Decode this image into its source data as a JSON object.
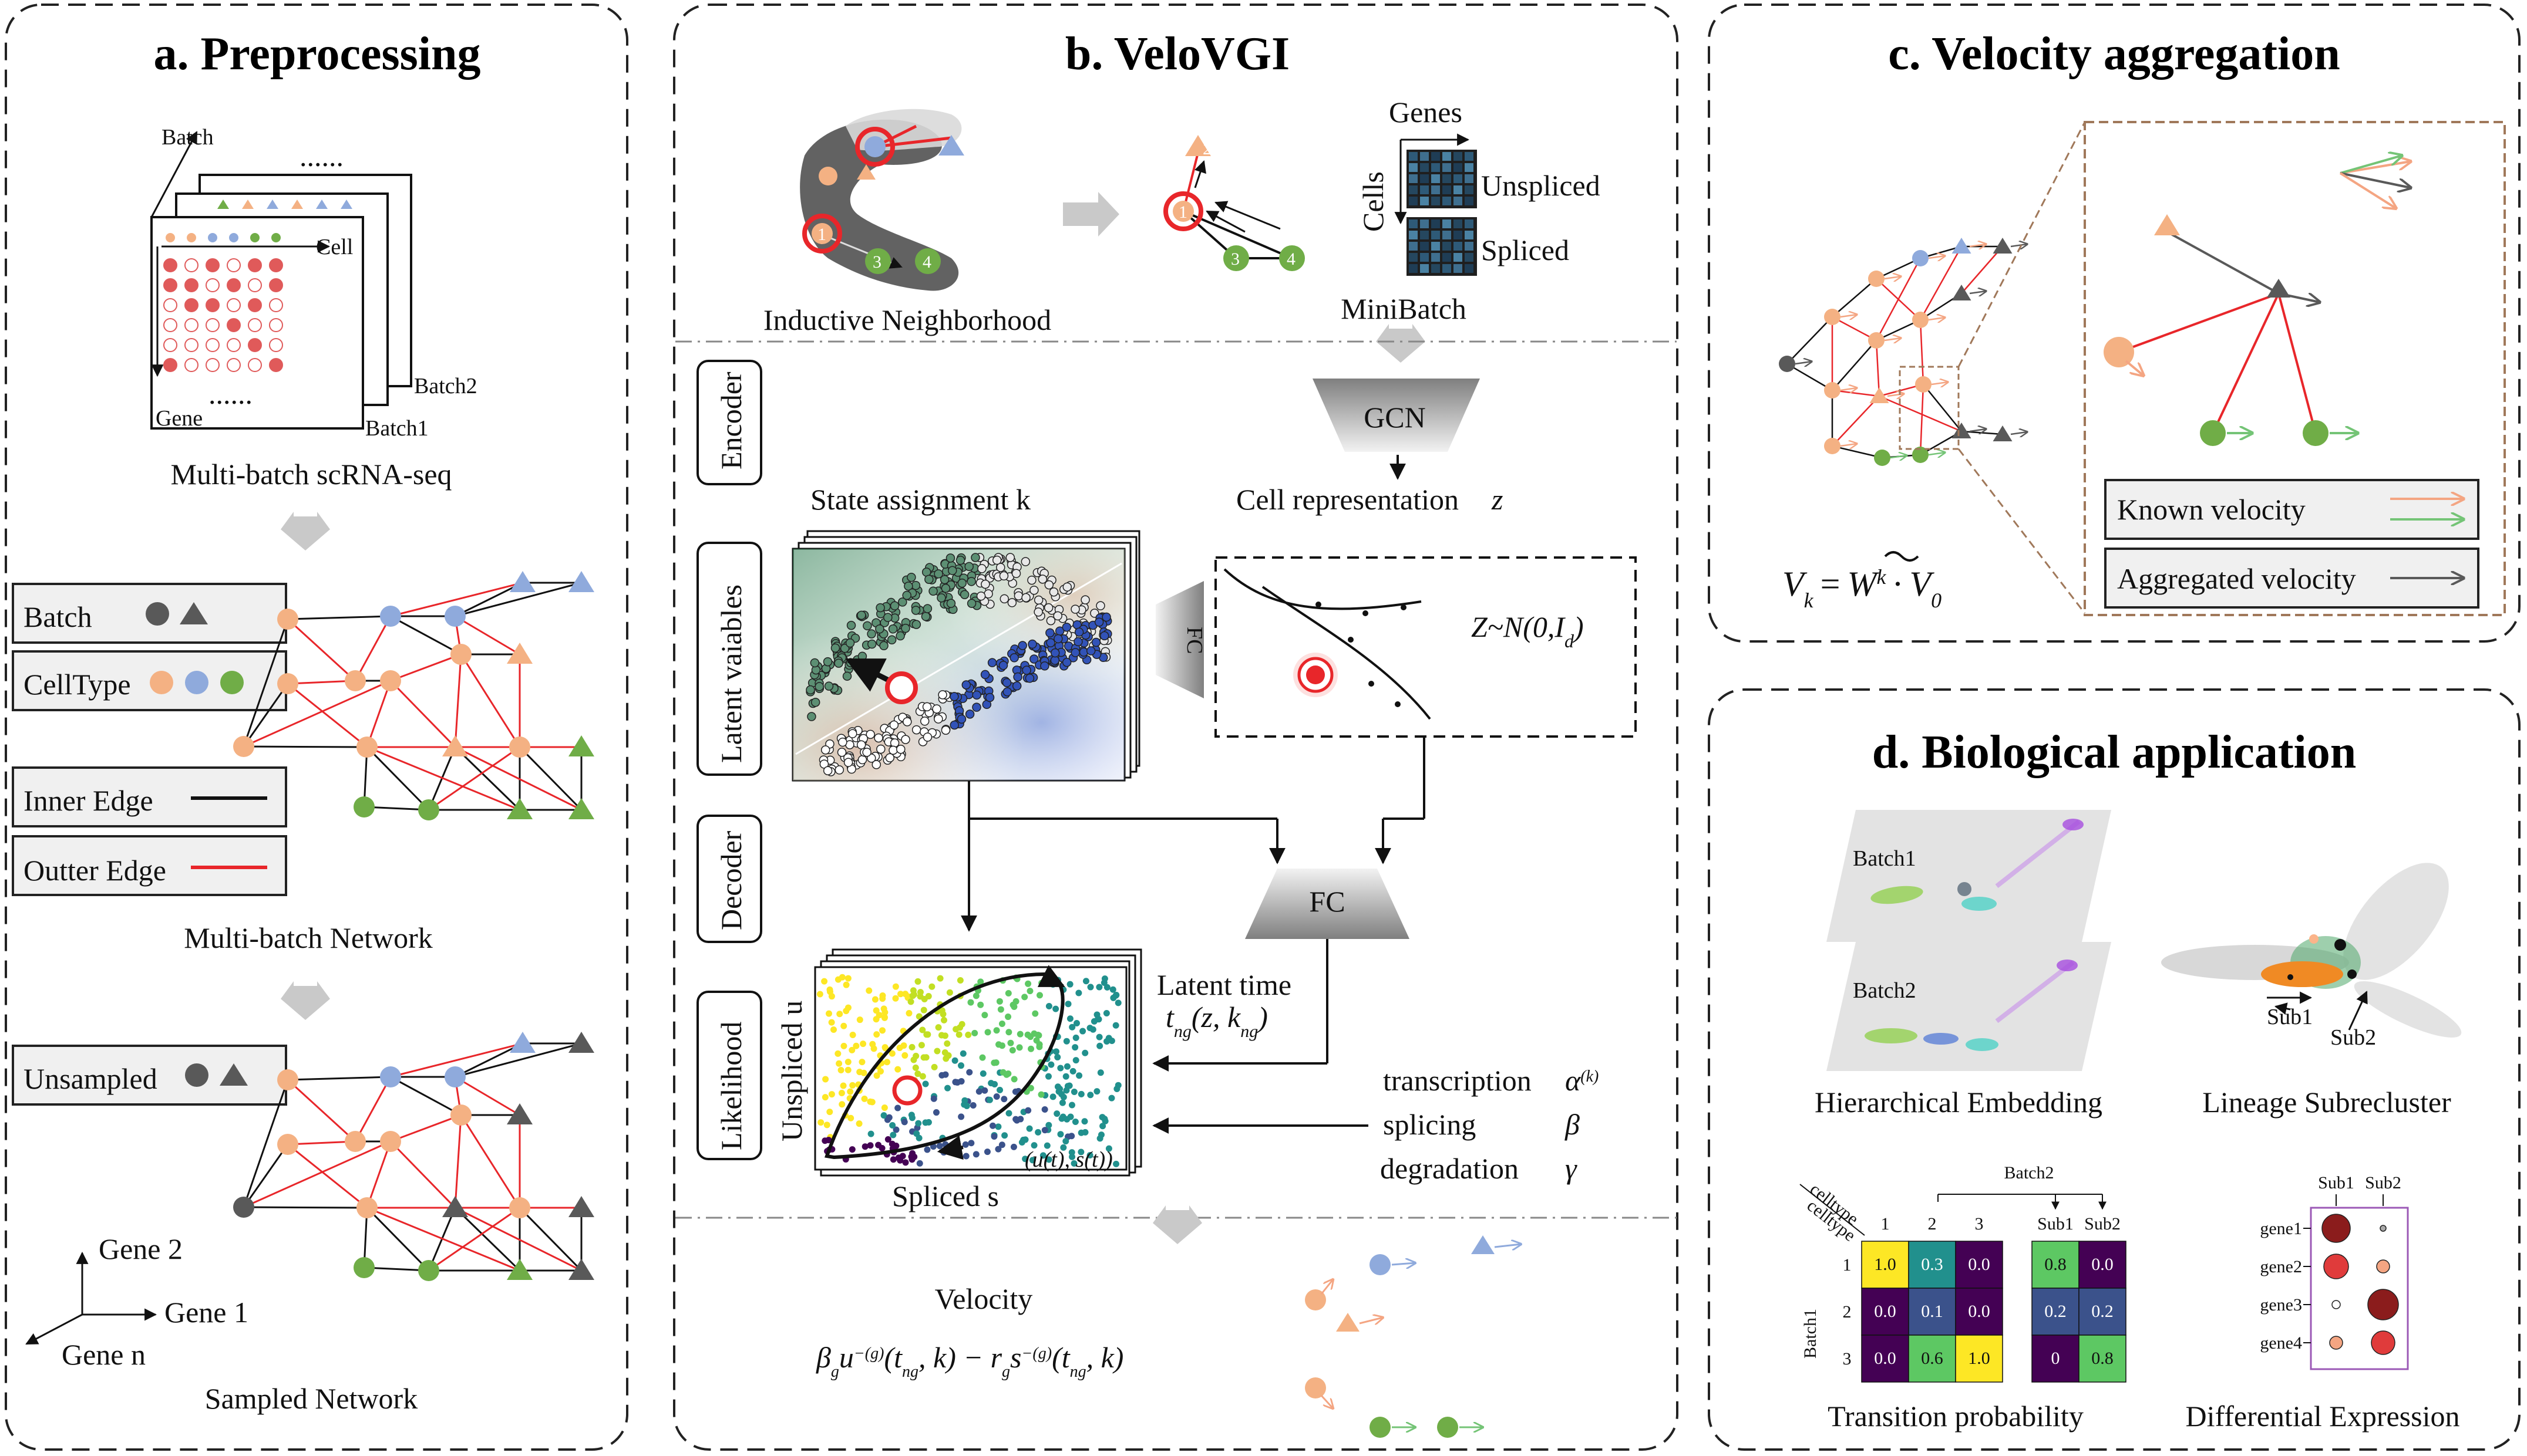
{
  "colors": {
    "orange": "#f4b183",
    "blue": "#8faadc",
    "green": "#70ad47",
    "dark": "#595959",
    "red": "#e8262a",
    "black": "#111111",
    "heat_purple": "#440154",
    "heat_blue": "#3b528b",
    "heat_teal": "#21908d",
    "heat_green": "#5dc863",
    "heat_yellow": "#fde725",
    "known_orange": "#f4a582",
    "known_green": "#74c476",
    "aggregated": "#595959"
  },
  "panel_a": {
    "title": "a. Preprocessing",
    "matrix_batch_axis": "Batch",
    "matrix_cell_axis": "Cell",
    "matrix_gene_axis": "Gene",
    "batch1": "Batch1",
    "batch2": "Batch2",
    "dots_h": "......",
    "dots_v": "......",
    "matrix_caption": "Multi-batch scRNA-seq",
    "legend_batch": "Batch",
    "legend_celltype": "CellType",
    "legend_inner": "Inner Edge",
    "legend_outer": "Outter Edge",
    "network_caption": "Multi-batch Network",
    "legend_unsampled": "Unsampled",
    "axis_gene2": "Gene 2",
    "axis_gene1": "Gene 1",
    "axis_genen": "Gene n",
    "sampled_caption": "Sampled Network"
  },
  "panel_b": {
    "title": "b. VeloVGI",
    "neighborhood_caption": "Inductive Neighborhood",
    "node_1": "1",
    "node_2": "2",
    "node_3": "3",
    "node_4": "4",
    "genes": "Genes",
    "cells": "Cells",
    "unspliced": "Unspliced",
    "spliced": "Spliced",
    "minibatch_caption": "MiniBatch",
    "encoder": "Encoder",
    "gcn": "GCN",
    "cell_repr": "Cell representation",
    "cell_repr_var": "z",
    "state_assign": "State assignment k",
    "latent_variables": "Latent vaiables",
    "fc_side": "FC",
    "prior": "Z~N(0,I",
    "prior_sub": "d",
    "prior_close": ")",
    "decoder": "Decoder",
    "fc_bottom": "FC",
    "likelihood": "Likelihood",
    "unspliced_u": "Unspliced u",
    "spliced_s": "Spliced s",
    "latent_time": "Latent time",
    "latent_time_formula": "t",
    "latent_time_formula_sub": "ng",
    "latent_time_formula_args": "(z,  k",
    "latent_time_formula_sub2": "ng",
    "latent_time_formula_close": ")",
    "ut_st": "(u(t), s(t))",
    "transcription": "transcription",
    "transcription_sym": "α",
    "transcription_sup": "(k)",
    "splicing": "splicing",
    "splicing_sym": "β",
    "degradation": "degradation",
    "degradation_sym": "γ",
    "velocity": "Velocity",
    "velocity_formula": "β",
    "velocity_formula_rest": "u",
    "velocity_formula_args": "(t",
    "velocity_formula_mid": ", k) − r",
    "velocity_formula_s": "s",
    "velocity_formula_end": ", k)",
    "velocity_sub_g": "g",
    "velocity_sup_g": "−(g)",
    "velocity_sub_ng": "ng"
  },
  "panel_c": {
    "title": "c. Velocity aggregation",
    "formula_v": "V",
    "formula_sub_k": "k",
    "formula_eq": "=",
    "formula_w": "W",
    "formula_sup_k": "k",
    "formula_dot": "·",
    "formula_v0": "V",
    "formula_sub_0": "0",
    "known_velocity": "Known velocity",
    "aggregated_velocity": "Aggregated velocity"
  },
  "panel_d": {
    "title": "d. Biological application",
    "batch1": "Batch1",
    "batch2": "Batch2",
    "hier_caption": "Hierarchical Embedding",
    "sub1": "Sub1",
    "sub2": "Sub2",
    "lineage_caption": "Lineage Subrecluster",
    "celltype_top": "celltype",
    "celltype_left": "celltype",
    "heat_batch2": "Batch2",
    "heat_batch1": "Batch1",
    "heat_cols": [
      "1",
      "2",
      "3"
    ],
    "heat_subcols": [
      "Sub1",
      "Sub2"
    ],
    "heat_rows": [
      "1",
      "2",
      "3"
    ],
    "heat_values": [
      [
        "1.0",
        "0.3",
        "0.0"
      ],
      [
        "0.0",
        "0.1",
        "0.0"
      ],
      [
        "0.0",
        "0.6",
        "1.0"
      ]
    ],
    "heat_sub_values": [
      [
        "0.8",
        "0.0"
      ],
      [
        "0.2",
        "0.2"
      ],
      [
        "0",
        "0.8"
      ]
    ],
    "transition_caption": "Transition probability",
    "de_cols": [
      "Sub1",
      "Sub2"
    ],
    "de_rows": [
      "gene1",
      "gene2",
      "gene3",
      "gene4"
    ],
    "de_caption": "Differential Expression"
  }
}
